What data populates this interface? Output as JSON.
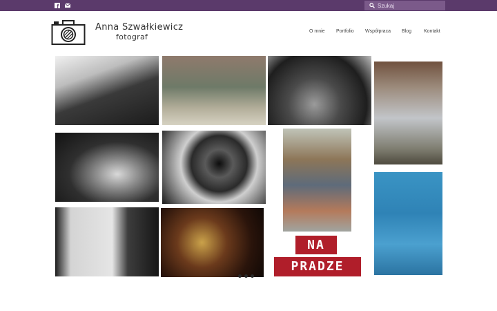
{
  "topbar": {
    "background": "#5b3a6b",
    "social_icons": [
      "facebook-icon",
      "mail-icon"
    ],
    "search": {
      "placeholder": "Szukaj",
      "value": ""
    }
  },
  "header": {
    "brand_name": "Anna Szwałkiewicz",
    "brand_subtitle": "fotograf",
    "nav": [
      {
        "label": "O mnie"
      },
      {
        "label": "Portfolio"
      },
      {
        "label": "Współpraca"
      },
      {
        "label": "Blog"
      },
      {
        "label": "Kontakt"
      }
    ]
  },
  "gallery": {
    "poster": {
      "line1": "NA",
      "line2": "PRADZE"
    },
    "slides": 3,
    "active_slide": 1
  }
}
